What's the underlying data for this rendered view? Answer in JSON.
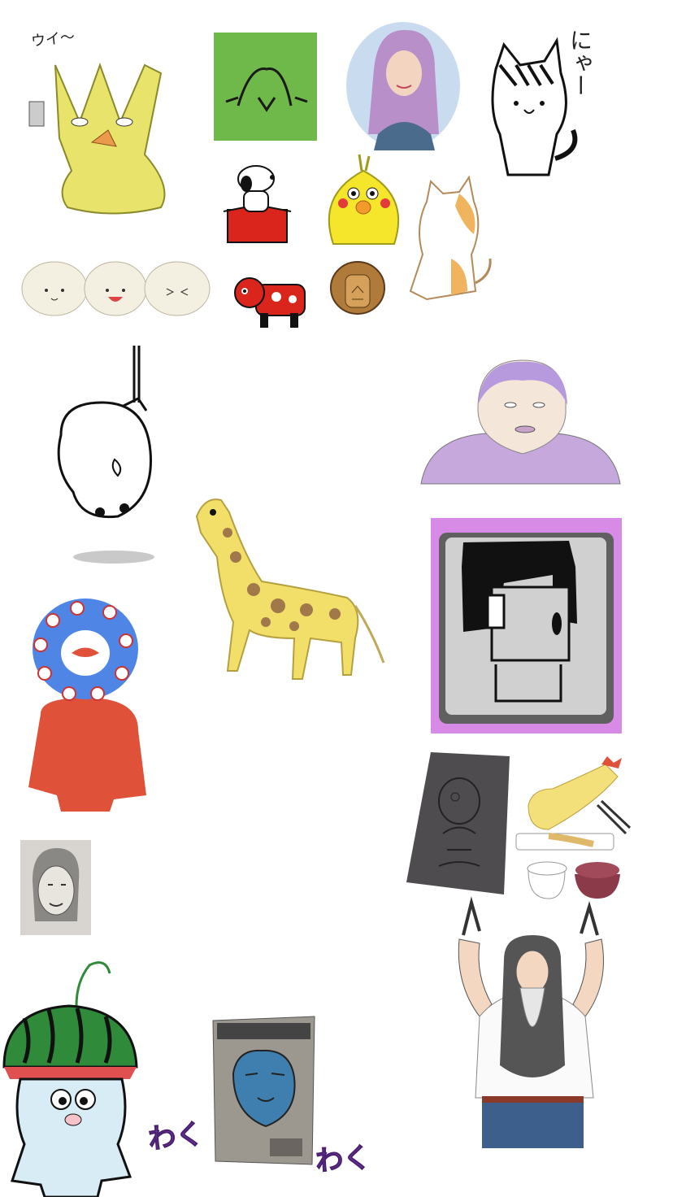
{
  "canvas": {
    "background": "#ffffff"
  },
  "labels": {
    "yellow_creature_caption": "ウイ〜",
    "cat_caption": "にゃー",
    "waku_left": "わく",
    "waku_right": "わく"
  },
  "colors": {
    "yellow_creature": "#e8e36a",
    "green_note": "#6fb84a",
    "portrait_bg": "#c9dcef",
    "purple_hair": "#b88fc9",
    "bird_yellow": "#f6e62b",
    "akabeko_red": "#d9251b",
    "giraffe": "#f2df6a",
    "giraffe_spots": "#a0784a",
    "eye_monster_blue": "#4f86e6",
    "eye_monster_body": "#e0513a",
    "tv_frame": "#d78ae6",
    "watermelon_green": "#2f8a3a",
    "mascot_body": "#d8ecf5",
    "waku_text": "#7a3fa8"
  },
  "icons": [
    "yellow-creature-sticker",
    "green-sticky-note-drawing",
    "purple-hair-woman-portrait",
    "nya-cat-doodle",
    "snoopy-doghouse-sticker",
    "yellow-bird-sticker",
    "calico-cat-sticker",
    "steamed-buns-trio",
    "akabeko-red-cow",
    "lion-cookie",
    "hanging-hamster-doodle",
    "giraffe-drawing",
    "purple-hair-old-woman-sketch",
    "black-hair-tv-character",
    "eye-ring-monster",
    "chalk-board-doodle",
    "shrimp-tempura-meal",
    "pencil-portrait",
    "watermelon-hat-mascot",
    "blue-head-snack-bag",
    "rock-gesture-long-hair-man"
  ]
}
